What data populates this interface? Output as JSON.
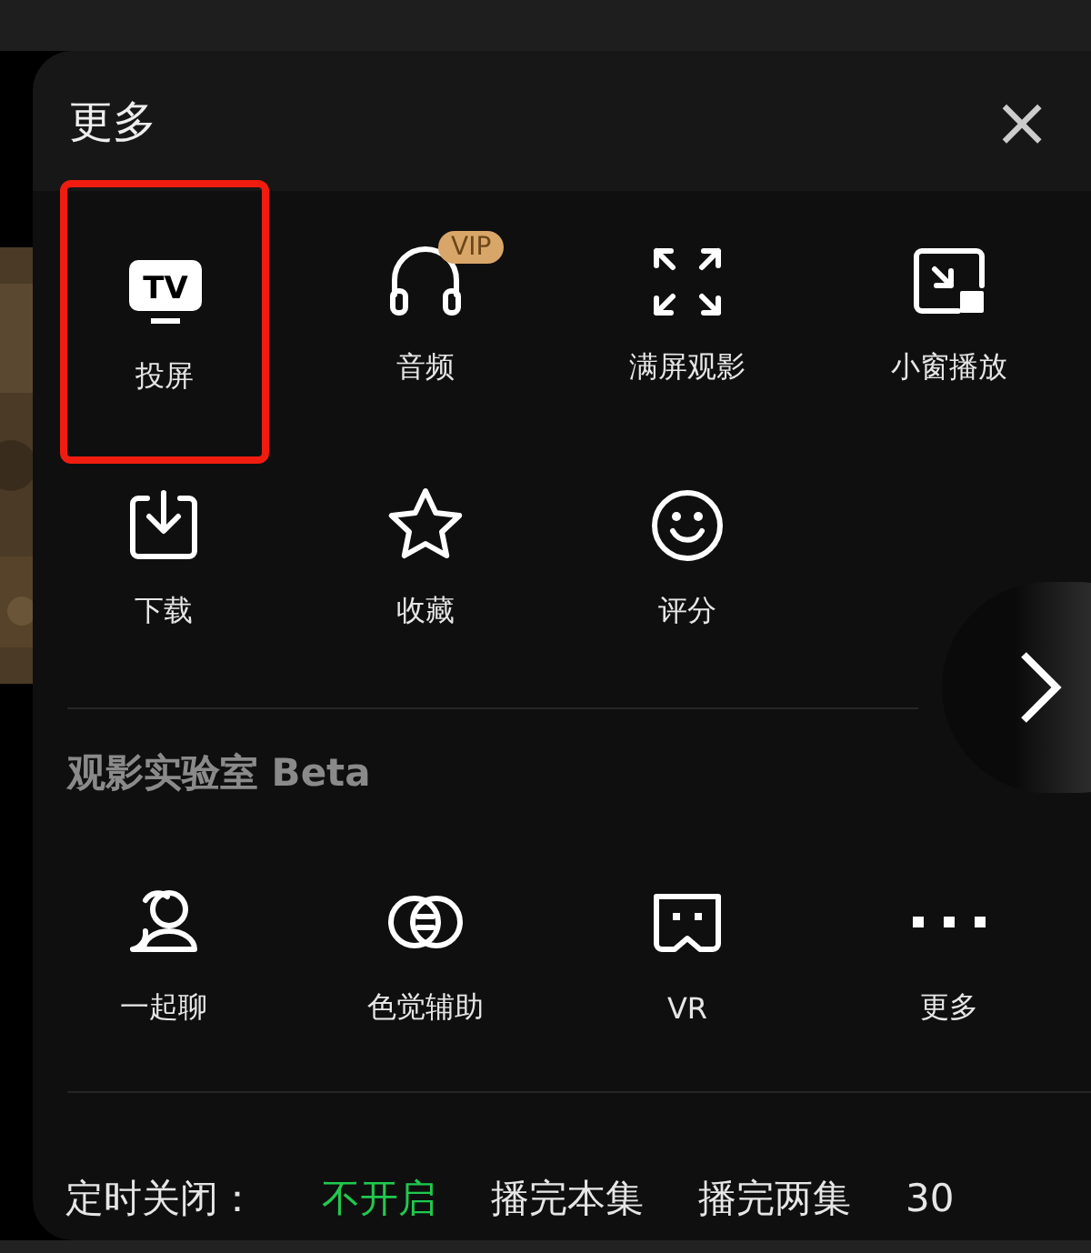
{
  "panel": {
    "title": "更多",
    "close": "×"
  },
  "actions": [
    {
      "label": "投屏",
      "icon_text": "TV",
      "highlighted": true
    },
    {
      "label": "音频",
      "badge": "VIP",
      "highlighted": false
    },
    {
      "label": "满屏观影",
      "highlighted": false
    },
    {
      "label": "小窗播放",
      "highlighted": false
    },
    {
      "label": "下载",
      "highlighted": false
    },
    {
      "label": "收藏",
      "highlighted": false
    },
    {
      "label": "评分",
      "highlighted": false
    }
  ],
  "lab": {
    "title": "观影实验室 Beta",
    "items": [
      {
        "label": "一起聊"
      },
      {
        "label": "色觉辅助"
      },
      {
        "label": "VR"
      },
      {
        "label": "更多"
      }
    ]
  },
  "timer": {
    "label": "定时关闭：",
    "options": [
      {
        "label": "不开启",
        "selected": true
      },
      {
        "label": "播完本集",
        "selected": false
      },
      {
        "label": "播完两集",
        "selected": false
      },
      {
        "label": "30",
        "selected": false
      }
    ]
  }
}
